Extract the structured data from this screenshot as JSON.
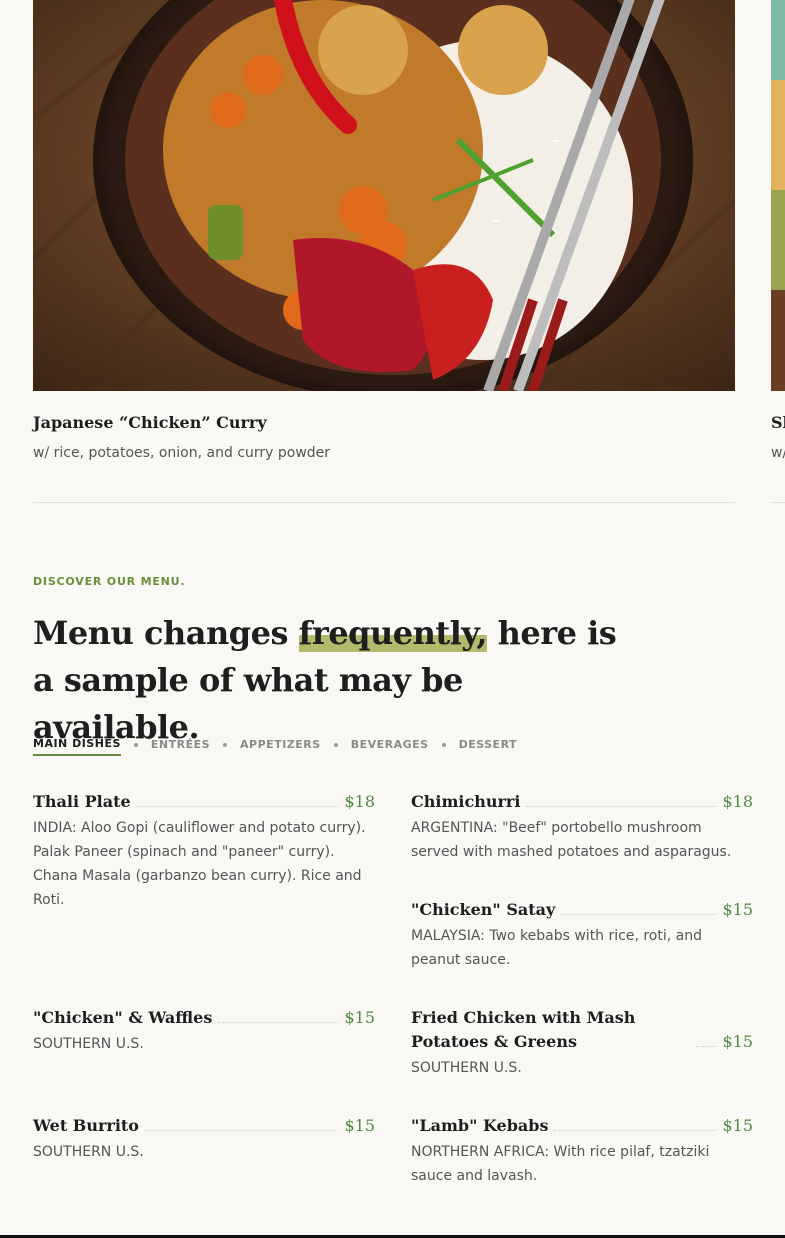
{
  "featured": {
    "slides": [
      {
        "title": "Japanese “Chicken” Curry",
        "description": "w/ rice, potatoes, onion, and curry powder"
      },
      {
        "title": "Sl",
        "description": "w/"
      }
    ]
  },
  "menu": {
    "eyebrow": "DISCOVER OUR MENU.",
    "headline_before": "Menu changes ",
    "headline_highlight": "frequently,",
    "headline_after": " here is a sample of what may be available.",
    "tabs": [
      {
        "label": "MAIN DISHES",
        "active": true
      },
      {
        "label": "ENTRÉES",
        "active": false
      },
      {
        "label": "APPETIZERS",
        "active": false
      },
      {
        "label": "BEVERAGES",
        "active": false
      },
      {
        "label": "DESSERT",
        "active": false
      }
    ],
    "items": [
      {
        "name": "Thali Plate",
        "price": "$18",
        "description": "INDIA: Aloo Gopi (cauliflower and potato curry). Palak Paneer (spinach and \"paneer\" curry). Chana Masala (garbanzo bean curry). Rice and Roti."
      },
      {
        "name": "Chimichurri",
        "price": "$18",
        "description": "ARGENTINA: \"Beef\" portobello mushroom served with mashed potatoes and asparagus."
      },
      {
        "name": "\"Chicken\" Satay",
        "price": "$15",
        "description": "MALAYSIA: Two kebabs with rice, roti, and peanut sauce."
      },
      {
        "name": "\"Chicken\" & Waffles",
        "price": "$15",
        "description": "SOUTHERN U.S."
      },
      {
        "name": "Fried Chicken with Mash Potatoes & Greens",
        "price": "$15",
        "description": "SOUTHERN U.S."
      },
      {
        "name": "Wet Burrito",
        "price": "$15",
        "description": "SOUTHERN U.S."
      },
      {
        "name": "\"Lamb\" Kebabs",
        "price": "$15",
        "description": "NORTHERN AFRICA: With rice pilaf, tzatziki sauce and lavash."
      }
    ]
  }
}
